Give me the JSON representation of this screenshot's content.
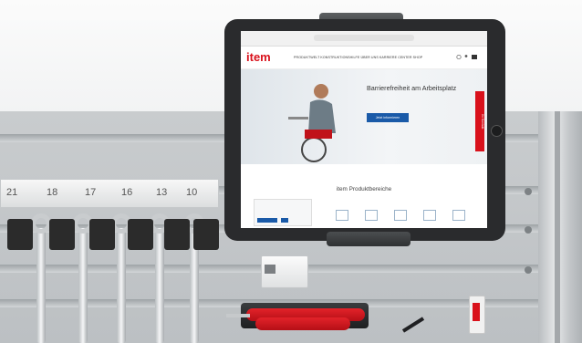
{
  "image": {
    "description": "",
    "scale_numbers": [
      "21",
      "18",
      "17",
      "16",
      "13",
      "10"
    ]
  },
  "tablet_screen": {
    "logo": "item",
    "menu": "PRODUKTWELT   KONSTRUKTIONSHILFE   ÜBER UNS   KARRIERE CENTER   SHOP",
    "hero_title": "Barrierefreiheit am Arbeitsplatz",
    "hero_subtitle": "",
    "hero_button": "Jetzt informieren",
    "side_tab": "Ihr Kontakt",
    "section_title": "item Produktbereiche",
    "info_text": ""
  },
  "colors": {
    "brand_red": "#d9111b",
    "button_blue": "#1a5aa8",
    "panel_gray": "#c3c6c9"
  },
  "objects": [
    "wrench-set-icon",
    "screwdriver-set-icon",
    "pen-icon",
    "marker-icon",
    "tablet-icon"
  ]
}
